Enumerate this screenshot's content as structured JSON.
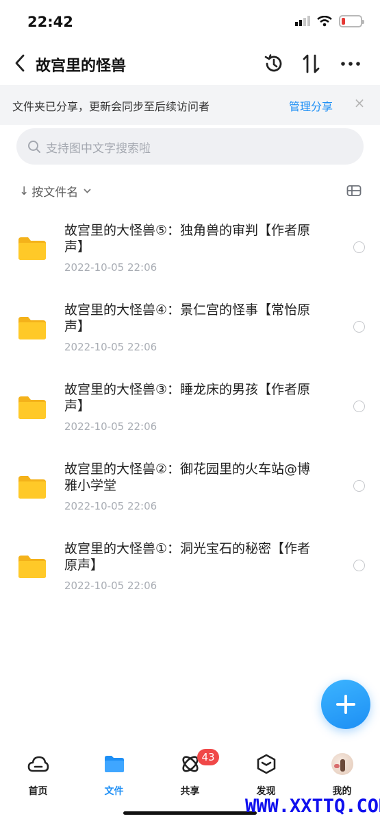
{
  "status_bar": {
    "time": "22:42",
    "battery_level": 0.2,
    "battery_color": "#e53935"
  },
  "nav": {
    "title": "故宫里的怪兽",
    "icons": [
      "back-chevron-icon",
      "history-icon",
      "sort-arrows-icon",
      "more-icon"
    ]
  },
  "share_banner": {
    "text": "文件夹已分享，更新会同步至后续访问者",
    "action_label": "管理分享",
    "close_label": "×"
  },
  "search": {
    "placeholder": "支持图中文字搜索啦"
  },
  "sort": {
    "arrow": "↓",
    "label": "按文件名"
  },
  "files": [
    {
      "name": "故宫里的大怪兽⑤：独角兽的审判【作者原声】",
      "date": "2022-10-05 22:06"
    },
    {
      "name": "故宫里的大怪兽④：景仁宫的怪事【常怡原声】",
      "date": "2022-10-05 22:06"
    },
    {
      "name": "故宫里的大怪兽③：睡龙床的男孩【作者原声】",
      "date": "2022-10-05 22:06"
    },
    {
      "name": "故宫里的大怪兽②：御花园里的火车站@博雅小学堂",
      "date": "2022-10-05 22:06"
    },
    {
      "name": "故宫里的大怪兽①：洞光宝石的秘密【作者原声】",
      "date": "2022-10-05 22:06"
    }
  ],
  "tabs": [
    {
      "label": "首页",
      "icon": "cloud-icon",
      "active": false
    },
    {
      "label": "文件",
      "icon": "folder-icon",
      "active": true
    },
    {
      "label": "共享",
      "icon": "atom-icon",
      "active": false
    },
    {
      "label": "发现",
      "icon": "cube-icon",
      "active": false
    },
    {
      "label": "我的",
      "icon": "avatar",
      "active": false
    }
  ],
  "share_badge": "43",
  "watermark": "WWW.XXTTQ.COM",
  "colors": {
    "accent": "#1e8ff5",
    "folder": "#ffc928",
    "badge": "#f04848"
  }
}
